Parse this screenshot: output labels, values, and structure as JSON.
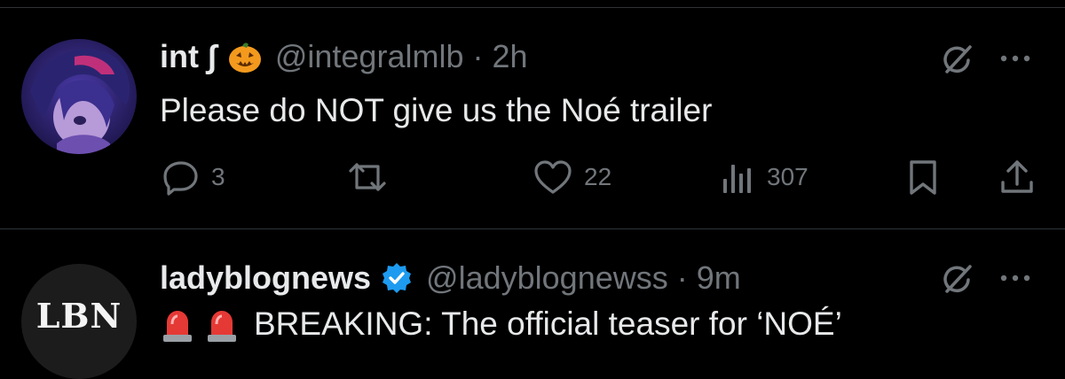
{
  "tweets": [
    {
      "display_name": "int ∫",
      "handle_time": "@integralmlb · 2h",
      "text": "Please do NOT give us the Noé trailer",
      "stats": {
        "replies": "3",
        "likes": "22",
        "views": "307"
      }
    },
    {
      "display_name": "ladyblognews",
      "avatar_text": "LBN",
      "handle_time": "@ladyblognewss · 9m",
      "text": "BREAKING: The official teaser for ‘NOÉ’"
    }
  ],
  "icons": {
    "name_emoji": "jack-o-lantern-icon",
    "verified": "verified-badge-icon",
    "grok": "grok-icon",
    "more": "more-icon",
    "reply": "reply-icon",
    "retweet": "retweet-icon",
    "like": "like-icon",
    "views": "views-icon",
    "bookmark": "bookmark-icon",
    "share": "share-icon",
    "siren": "siren-emoji-icon"
  },
  "colors": {
    "background": "#000000",
    "text": "#e7e9ea",
    "muted": "#71767b",
    "divider": "#2f3336",
    "verified": "#1d9bf0"
  }
}
